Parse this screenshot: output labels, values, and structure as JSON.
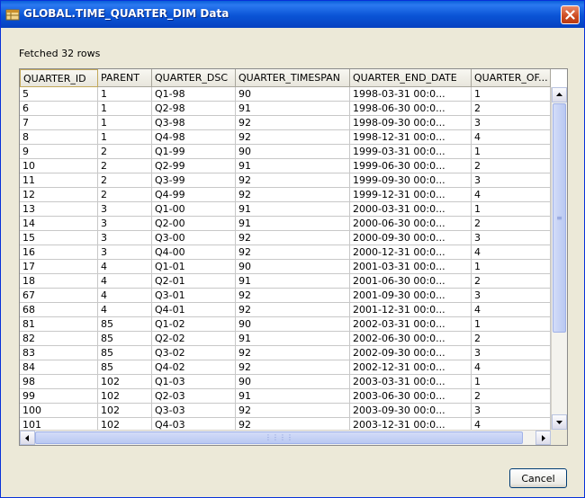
{
  "window": {
    "title": "GLOBAL.TIME_QUARTER_DIM Data",
    "close_icon": "close-icon",
    "app_icon": "database-table-icon"
  },
  "status": {
    "text": "Fetched 32 rows"
  },
  "table": {
    "columns": [
      "QUARTER_ID",
      "PARENT",
      "QUARTER_DSC",
      "QUARTER_TIMESPAN",
      "QUARTER_END_DATE",
      "QUARTER_OF..."
    ],
    "rows": [
      [
        "5",
        "1",
        "Q1-98",
        "90",
        "1998-03-31 00:0...",
        "1"
      ],
      [
        "6",
        "1",
        "Q2-98",
        "91",
        "1998-06-30 00:0...",
        "2"
      ],
      [
        "7",
        "1",
        "Q3-98",
        "92",
        "1998-09-30 00:0...",
        "3"
      ],
      [
        "8",
        "1",
        "Q4-98",
        "92",
        "1998-12-31 00:0...",
        "4"
      ],
      [
        "9",
        "2",
        "Q1-99",
        "90",
        "1999-03-31 00:0...",
        "1"
      ],
      [
        "10",
        "2",
        "Q2-99",
        "91",
        "1999-06-30 00:0...",
        "2"
      ],
      [
        "11",
        "2",
        "Q3-99",
        "92",
        "1999-09-30 00:0...",
        "3"
      ],
      [
        "12",
        "2",
        "Q4-99",
        "92",
        "1999-12-31 00:0...",
        "4"
      ],
      [
        "13",
        "3",
        "Q1-00",
        "91",
        "2000-03-31 00:0...",
        "1"
      ],
      [
        "14",
        "3",
        "Q2-00",
        "91",
        "2000-06-30 00:0...",
        "2"
      ],
      [
        "15",
        "3",
        "Q3-00",
        "92",
        "2000-09-30 00:0...",
        "3"
      ],
      [
        "16",
        "3",
        "Q4-00",
        "92",
        "2000-12-31 00:0...",
        "4"
      ],
      [
        "17",
        "4",
        "Q1-01",
        "90",
        "2001-03-31 00:0...",
        "1"
      ],
      [
        "18",
        "4",
        "Q2-01",
        "91",
        "2001-06-30 00:0...",
        "2"
      ],
      [
        "67",
        "4",
        "Q3-01",
        "92",
        "2001-09-30 00:0...",
        "3"
      ],
      [
        "68",
        "4",
        "Q4-01",
        "92",
        "2001-12-31 00:0...",
        "4"
      ],
      [
        "81",
        "85",
        "Q1-02",
        "90",
        "2002-03-31 00:0...",
        "1"
      ],
      [
        "82",
        "85",
        "Q2-02",
        "91",
        "2002-06-30 00:0...",
        "2"
      ],
      [
        "83",
        "85",
        "Q3-02",
        "92",
        "2002-09-30 00:0...",
        "3"
      ],
      [
        "84",
        "85",
        "Q4-02",
        "92",
        "2002-12-31 00:0...",
        "4"
      ],
      [
        "98",
        "102",
        "Q1-03",
        "90",
        "2003-03-31 00:0...",
        "1"
      ],
      [
        "99",
        "102",
        "Q2-03",
        "91",
        "2003-06-30 00:0...",
        "2"
      ],
      [
        "100",
        "102",
        "Q3-03",
        "92",
        "2003-09-30 00:0...",
        "3"
      ],
      [
        "101",
        "102",
        "Q4-03",
        "92",
        "2003-12-31 00:0...",
        "4"
      ]
    ]
  },
  "buttons": {
    "cancel_label": "Cancel"
  },
  "colors": {
    "titlebar": "#0a54d6",
    "dialog_bg": "#ece9d8",
    "scroll_thumb": "#b9c8f2"
  }
}
